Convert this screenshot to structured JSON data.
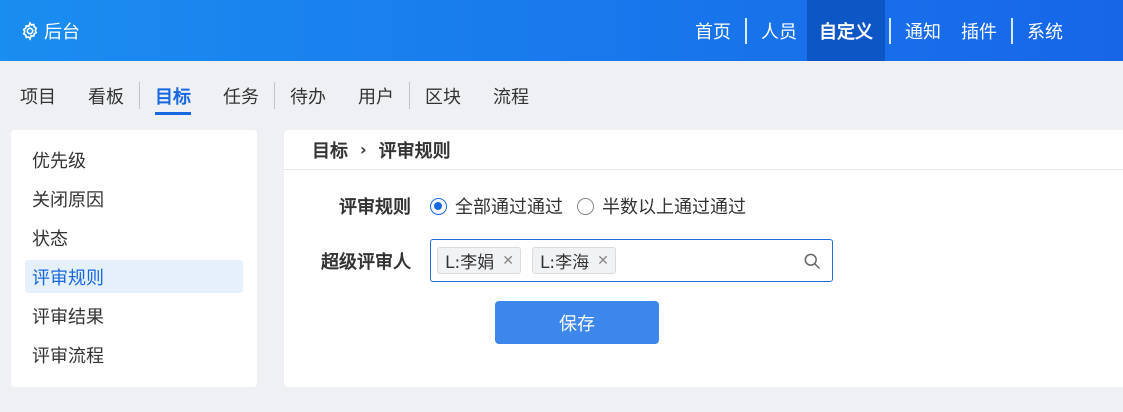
{
  "colors": {
    "topbar": "#1a8df0",
    "active_top": "#0d56c5",
    "accent": "#1768e0",
    "button": "#3d86ec"
  },
  "brand": {
    "icon": "gear-icon",
    "label": "后台"
  },
  "topnav": {
    "items": [
      "首页",
      "人员",
      "自定义",
      "通知",
      "插件",
      "系统"
    ],
    "active": "自定义"
  },
  "subnav": {
    "tabs": [
      "项目",
      "看板",
      "目标",
      "任务",
      "待办",
      "用户",
      "区块",
      "流程"
    ],
    "active": "目标"
  },
  "sidebar": {
    "items": [
      "优先级",
      "关闭原因",
      "状态",
      "评审规则",
      "评审结果",
      "评审流程"
    ],
    "active": "评审规则"
  },
  "breadcrumb": {
    "parent": "目标",
    "current": "评审规则"
  },
  "form": {
    "rule_label": "评审规则",
    "rule_options": [
      "全部通过通过",
      "半数以上通过通过"
    ],
    "rule_selected": "全部通过通过",
    "reviewer_label": "超级评审人",
    "reviewers": [
      "L:李娟",
      "L:李海"
    ],
    "save_label": "保存"
  }
}
